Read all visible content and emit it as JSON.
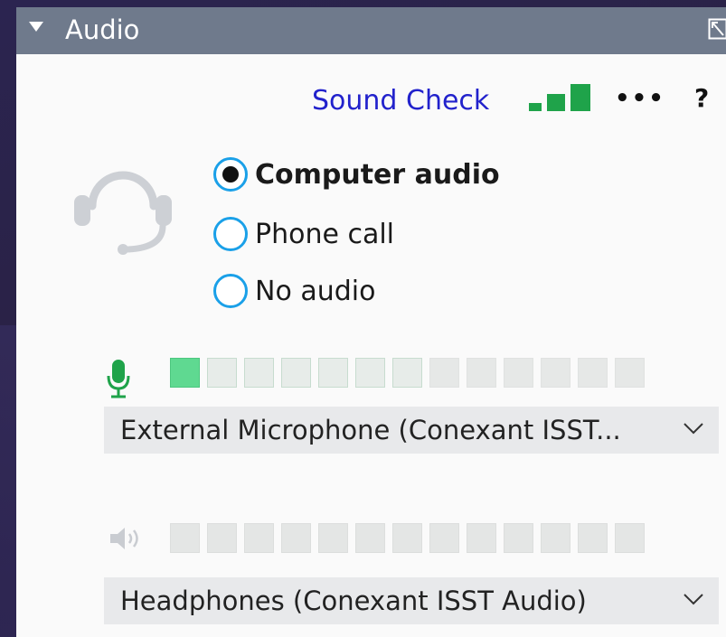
{
  "header": {
    "title": "Audio"
  },
  "toolbar": {
    "sound_check": "Sound Check",
    "more": "•••",
    "help": "?"
  },
  "audio_options": [
    {
      "label": "Computer audio",
      "selected": true
    },
    {
      "label": "Phone call",
      "selected": false
    },
    {
      "label": "No audio",
      "selected": false
    }
  ],
  "microphone": {
    "device": "External Microphone (Conexant ISST...",
    "level_segments_active": 1,
    "total_segments": 13
  },
  "speaker": {
    "device": "Headphones (Conexant ISST Audio)",
    "level_segments_active": 0,
    "total_segments": 13
  },
  "colors": {
    "header": "#6f7a8c",
    "accent_blue": "#1aa0e8",
    "link": "#2222cc",
    "green": "#1fa34a",
    "meter_on": "#5fd991"
  },
  "icons": {
    "collapse": "triangle-down-icon",
    "popout": "popout-icon",
    "signal": "signal-strength-icon",
    "headset": "headset-icon",
    "mic": "microphone-icon",
    "speaker": "speaker-icon",
    "chevron": "chevron-down-icon"
  }
}
